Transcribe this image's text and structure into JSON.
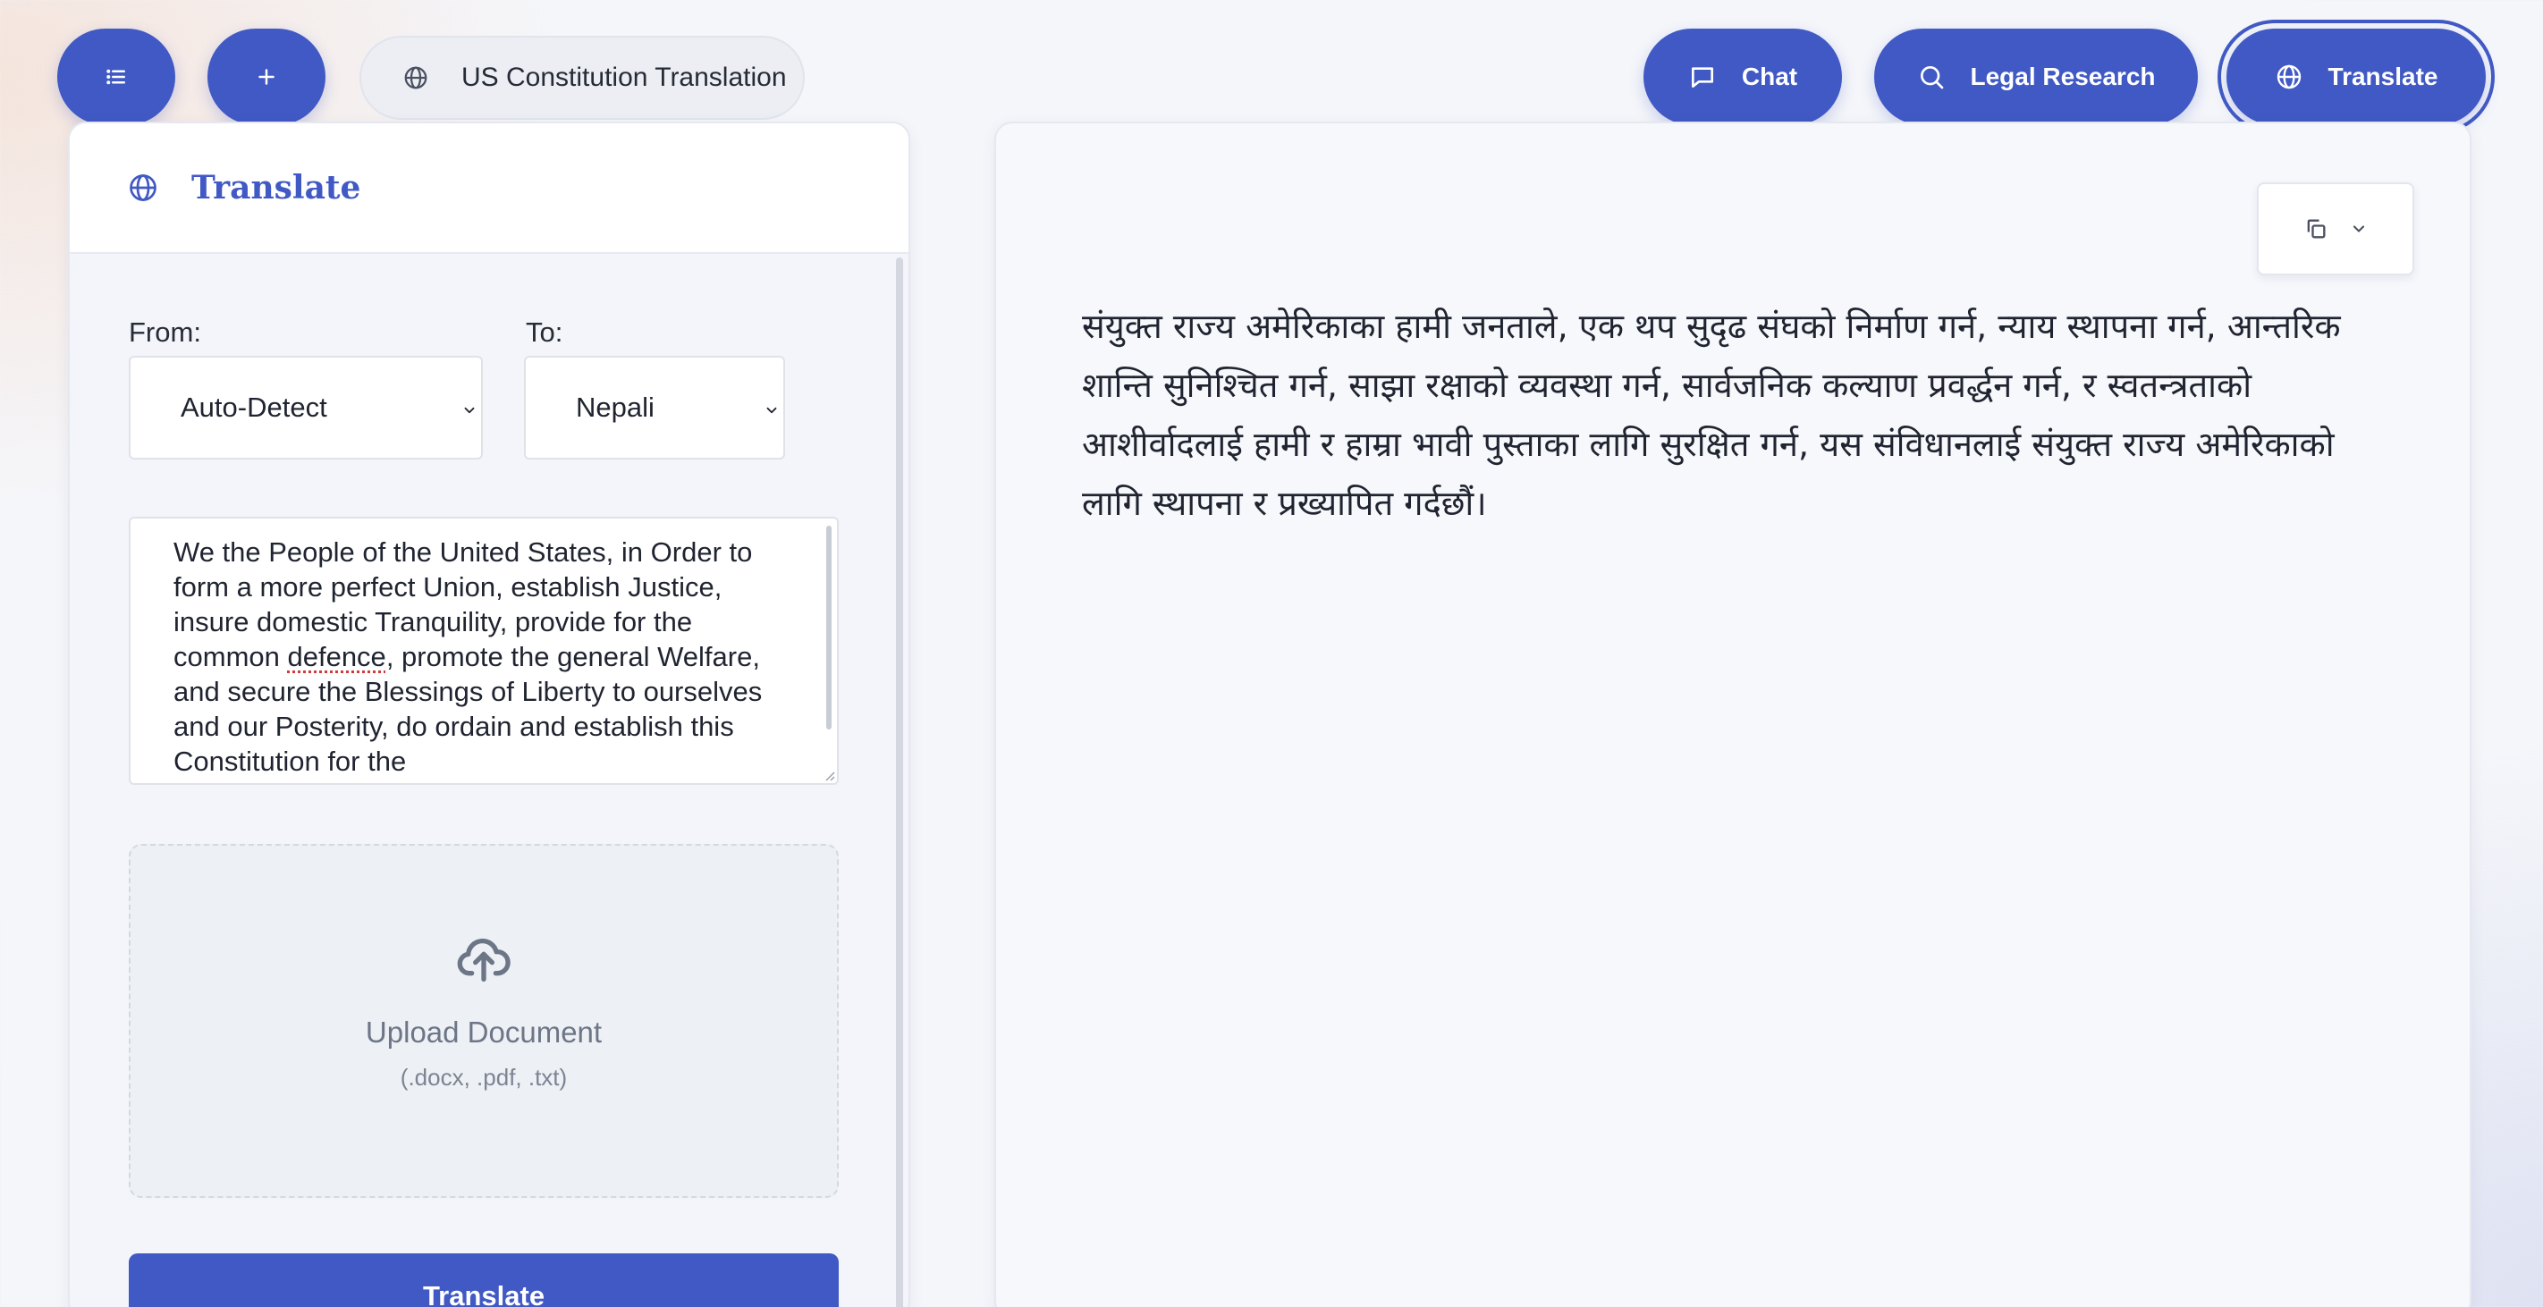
{
  "topbar": {
    "menu_icon": "list-icon",
    "new_icon": "plus-icon",
    "conversation_title": "US Constitution Translation",
    "conversation_icon": "globe-icon"
  },
  "nav": {
    "chat_label": "Chat",
    "research_label": "Legal Research",
    "translate_label": "Translate",
    "active": "Translate"
  },
  "panel": {
    "title": "Translate",
    "from_label": "From:",
    "to_label": "To:",
    "from_value": "Auto-Detect",
    "to_value": "Nepali",
    "source_text_before": "We the People of the United States, in Order to form a more perfect Union, establish Justice, insure domestic Tranquility, provide for the common ",
    "source_text_flagged": "defence",
    "source_text_after": ", promote the general Welfare, and secure the Blessings of Liberty to ourselves and our Posterity, do ordain and establish this Constitution for the",
    "upload_title": "Upload Document",
    "upload_types": "(.docx, .pdf, .txt)",
    "submit_label": "Translate"
  },
  "output": {
    "text": "संयुक्त राज्य अमेरिकाका हामी जनताले, एक थप सुदृढ संघको निर्माण गर्न, न्याय स्थापना गर्न, आन्तरिक शान्ति सुनिश्चित गर्न, साझा रक्षाको व्यवस्था गर्न, सार्वजनिक कल्याण प्रवर्द्धन गर्न, र स्वतन्त्रताको आशीर्वादलाई हामी र हाम्रा भावी पुस्ताका लागि सुरक्षित गर्न, यस संविधानलाई संयुक्त राज्य अमेरिकाको लागि स्थापना र प्रख्यापित गर्दछौं।"
  },
  "colors": {
    "accent": "#4059c4",
    "panel_bg": "#f3f5fa",
    "muted_text": "#6d7686"
  }
}
